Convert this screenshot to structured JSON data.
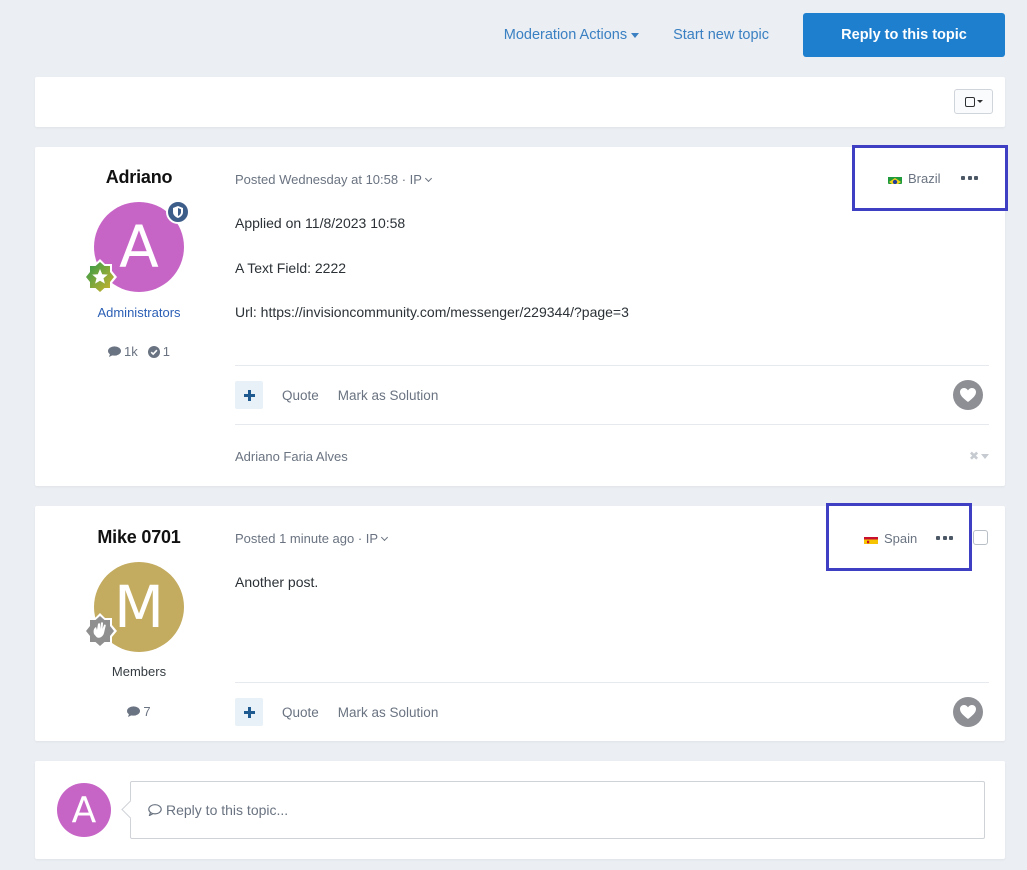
{
  "toolbar": {
    "moderation_label": "Moderation Actions",
    "start_topic_label": "Start new topic",
    "reply_label": "Reply to this topic"
  },
  "posts": [
    {
      "author": "Adriano",
      "avatar_letter": "A",
      "avatar_color": "#c765c7",
      "group": "Administrators",
      "group_color": "#2b5fb5",
      "posts_count": "1k",
      "solutions_count": "1",
      "meta": "Posted Wednesday at 10:58 · IP",
      "country": "Brazil",
      "content": [
        "Applied on 11/8/2023 10:58",
        "A Text Field: 2222",
        "Url: https://invisioncommunity.com/messenger/229344/?page=3"
      ],
      "quote_label": "Quote",
      "solution_label": "Mark as Solution",
      "signature": "Adriano Faria Alves"
    },
    {
      "author": "Mike 0701",
      "avatar_letter": "M",
      "avatar_color": "#c3ab5f",
      "group": "Members",
      "group_color": "#353c41",
      "posts_count": "7",
      "meta": "Posted 1 minute ago · IP",
      "country": "Spain",
      "content": [
        "Another post."
      ],
      "quote_label": "Quote",
      "solution_label": "Mark as Solution"
    }
  ],
  "reply_box": {
    "avatar_letter": "A",
    "placeholder": "Reply to this topic..."
  },
  "colors": {
    "accent": "#1e7fcf",
    "highlight_box": "#3f3fc4"
  }
}
